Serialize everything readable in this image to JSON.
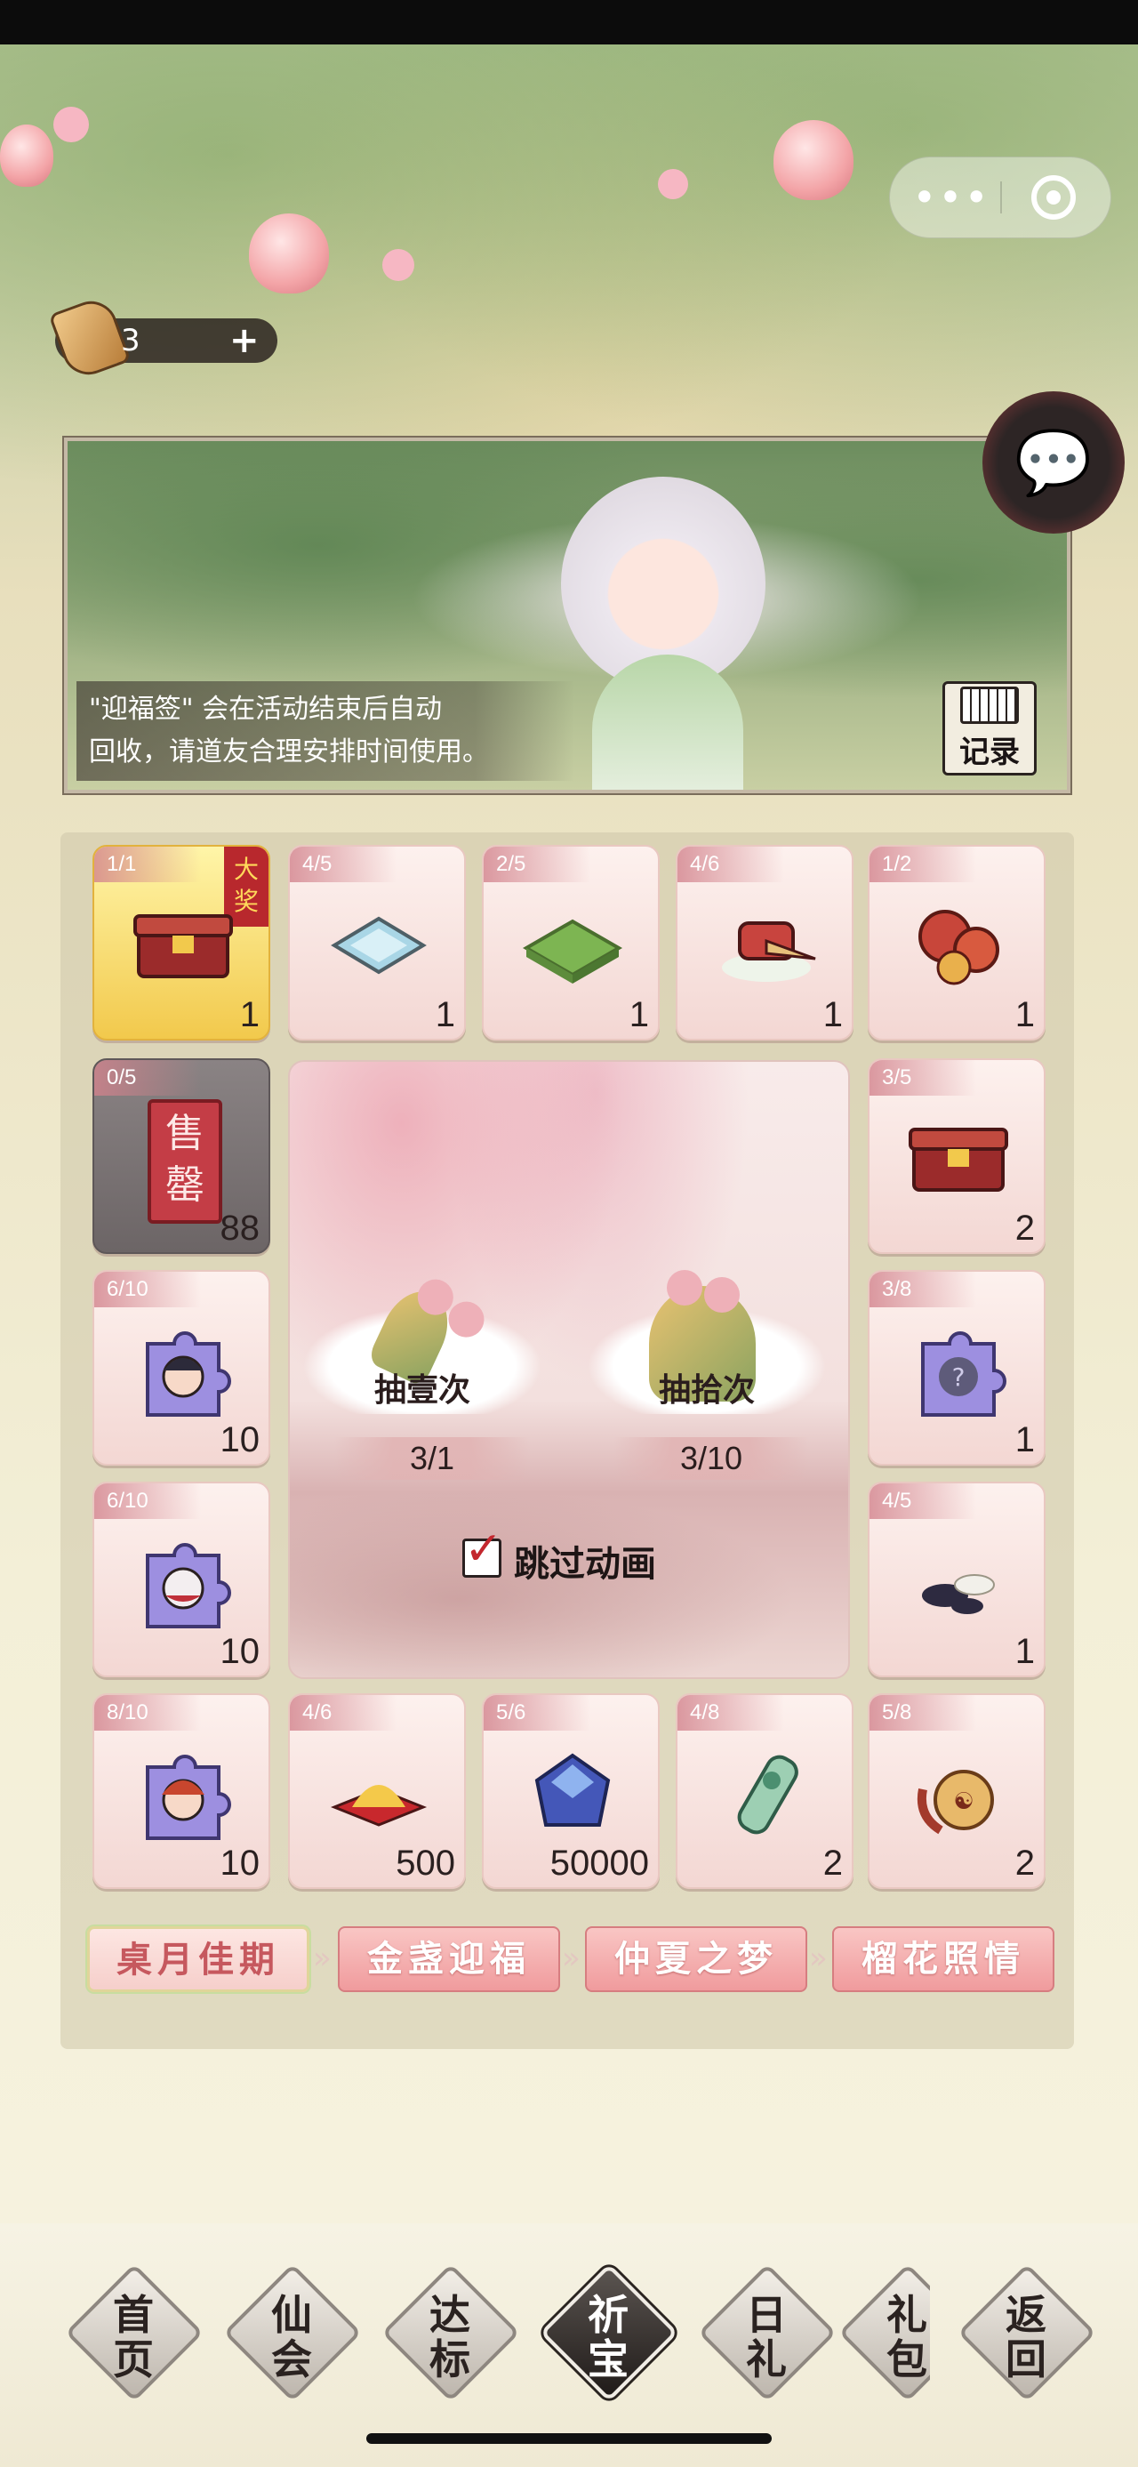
{
  "currency": {
    "count": "3",
    "plus": "+"
  },
  "capsule": {
    "menu_glyph": "•••"
  },
  "banner": {
    "notice_line1": "\"迎福签\" 会在活动结束后自动",
    "notice_line2": "回收，请道友合理安排时间使用。",
    "record_label": "记录"
  },
  "grid": {
    "cells": [
      {
        "progress": "1/1",
        "qty": "1",
        "icon": "treasure-chest-icon",
        "badge": "大奖"
      },
      {
        "progress": "4/5",
        "qty": "1",
        "icon": "water-pool-tile-icon"
      },
      {
        "progress": "2/5",
        "qty": "1",
        "icon": "grass-tile-icon"
      },
      {
        "progress": "4/6",
        "qty": "1",
        "icon": "bird-chariot-icon"
      },
      {
        "progress": "1/2",
        "qty": "1",
        "icon": "red-fungus-icon"
      },
      {
        "progress": "0/5",
        "qty": "88",
        "icon": "sold-out-icon",
        "stamp": "售罄"
      },
      {
        "progress": "3/5",
        "qty": "2",
        "icon": "treasure-chest-icon"
      },
      {
        "progress": "6/10",
        "qty": "10",
        "icon": "character-puzzle-piece-icon"
      },
      {
        "progress": "3/8",
        "qty": "1",
        "icon": "mystery-puzzle-piece-icon"
      },
      {
        "progress": "6/10",
        "qty": "10",
        "icon": "character-puzzle-piece-icon"
      },
      {
        "progress": "4/5",
        "qty": "1",
        "icon": "go-stones-icon"
      },
      {
        "progress": "8/10",
        "qty": "10",
        "icon": "character-puzzle-piece-icon"
      },
      {
        "progress": "4/6",
        "qty": "500",
        "icon": "gold-dust-icon"
      },
      {
        "progress": "5/6",
        "qty": "50000",
        "icon": "blue-gem-icon"
      },
      {
        "progress": "4/8",
        "qty": "2",
        "icon": "jade-token-icon"
      },
      {
        "progress": "5/8",
        "qty": "2",
        "icon": "gourd-pouch-icon"
      }
    ]
  },
  "draw": {
    "single": {
      "label": "抽壹次",
      "count": "3/1"
    },
    "ten": {
      "label": "抽拾次",
      "count": "3/10"
    },
    "skip_label": "跳过动画",
    "skip_checked": true
  },
  "stages": [
    {
      "label": "桌月佳期",
      "active": true
    },
    {
      "label": "金盏迎福",
      "active": false
    },
    {
      "label": "仲夏之梦",
      "active": false
    },
    {
      "label": "榴花照情",
      "active": false
    }
  ],
  "nav": [
    {
      "label": "首\n页",
      "active": false
    },
    {
      "label": "仙\n会",
      "active": false
    },
    {
      "label": "达\n标",
      "active": false
    },
    {
      "label": "祈\n宝",
      "active": true
    },
    {
      "label": "日\n礼",
      "active": false
    },
    {
      "label": "礼\n包",
      "active": false
    },
    {
      "label": "返\n回",
      "active": false
    }
  ]
}
